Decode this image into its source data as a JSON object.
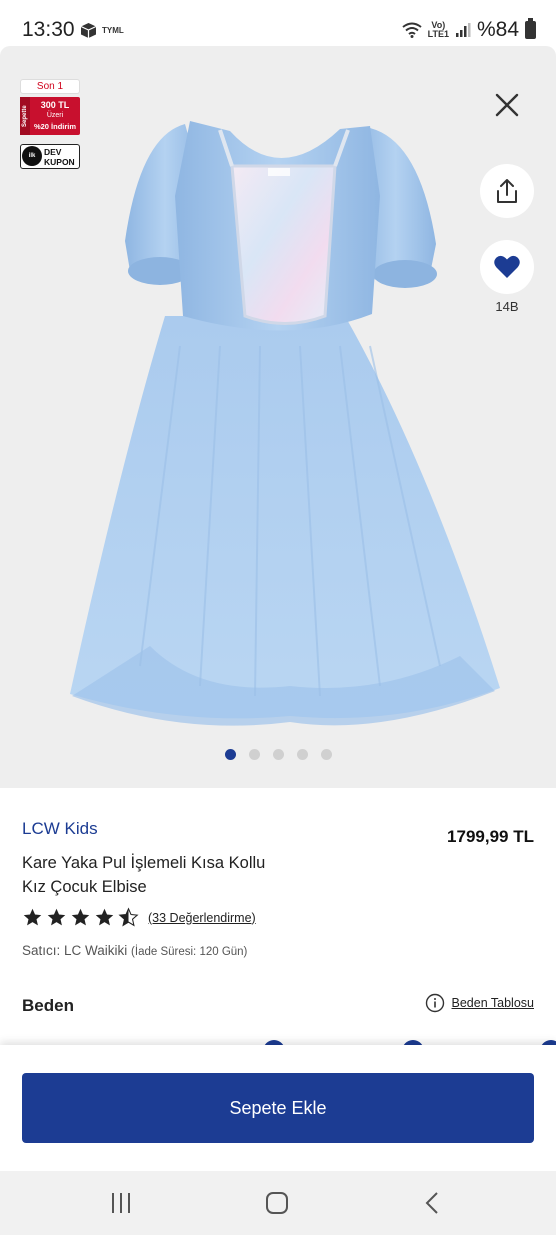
{
  "status_bar": {
    "time": "13:30",
    "carrier": "TYML",
    "network_top": "Vo)",
    "network_bottom": "LTE1",
    "battery": "%84"
  },
  "gallery": {
    "badges": {
      "stock": "Son 1",
      "promo_side": "Sepette",
      "promo_line1": "300 TL",
      "promo_line2": "Üzeri",
      "promo_line3": "%20 İndirim",
      "coupon_circle": "ilk",
      "coupon_line1": "DEV",
      "coupon_line2": "KUPON"
    },
    "favorite_count": "14B",
    "slide_count": 5,
    "active_slide": 0
  },
  "product": {
    "brand": "LCW Kids",
    "price": "1799,99 TL",
    "name": "Kare Yaka Pul İşlemeli Kısa Kollu Kız Çocuk Elbise",
    "rating_value": 4.5,
    "review_link": "(33 Değerlendirme)",
    "seller_label": "Satıcı: LC Waikiki",
    "return_period": "(İade Süresi: 120 Gün)"
  },
  "size": {
    "title": "Beden",
    "table_link": "Beden Tablosu"
  },
  "cart": {
    "button_label": "Sepete Ekle"
  },
  "colors": {
    "accent": "#1c3c93",
    "promo_red": "#c8102e",
    "dress_blue": "#a9cbeb"
  }
}
